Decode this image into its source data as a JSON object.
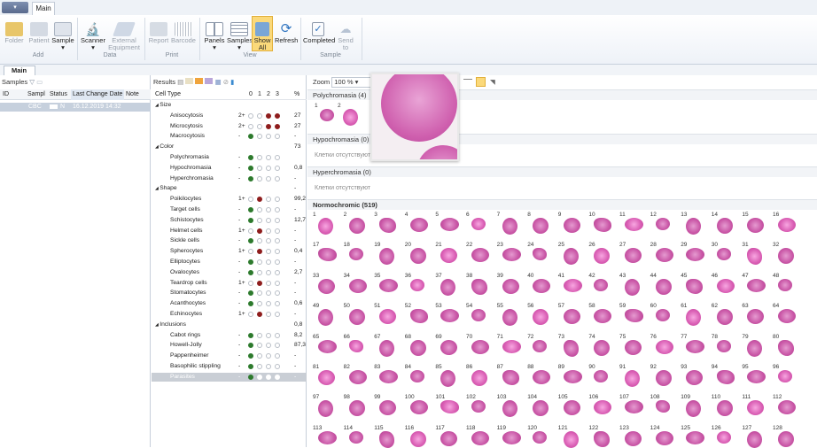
{
  "ribbon": {
    "tab": "Main",
    "groups": {
      "add": "Add",
      "data": "Data",
      "print": "Print",
      "view": "View",
      "sample": "Sample"
    },
    "buttons": {
      "folder": "Folder",
      "patient": "Patient",
      "sample": "Sample",
      "scanner": "Scanner",
      "external": "External Equipment",
      "report": "Report",
      "barcode": "Barcode",
      "panels": "Panels",
      "samples": "Samples",
      "show_all": "Show All",
      "refresh": "Refresh",
      "completed": "Completed",
      "send": "Send to"
    }
  },
  "doc_tab": "Main",
  "samples_panel": {
    "title": "Samples",
    "columns": [
      "ID",
      "Sampl",
      "Status",
      "Last Change Date",
      "Note"
    ],
    "row": {
      "sample": "CBC",
      "status": "N",
      "date": "16.12.2019 14:32"
    }
  },
  "results_panel": {
    "title": "Results",
    "header": {
      "cell_type": "Cell Type",
      "g0": "0",
      "g1": "1",
      "g2": "2",
      "g3": "3",
      "pct": "%"
    },
    "rows": [
      {
        "type": "cat",
        "name": "Size",
        "grade": "",
        "dots": [],
        "pct": ""
      },
      {
        "type": "item",
        "name": "Anisocytosis",
        "grade": "2+",
        "dots": [
          "o",
          "o",
          "r",
          "r"
        ],
        "pct": "27"
      },
      {
        "type": "item",
        "name": "Microcytosis",
        "grade": "2+",
        "dots": [
          "o",
          "o",
          "r",
          "r"
        ],
        "pct": "27"
      },
      {
        "type": "item",
        "name": "Macrocytosis",
        "grade": "-",
        "dots": [
          "g",
          "o",
          "o",
          "o"
        ],
        "pct": "-"
      },
      {
        "type": "cat",
        "name": "Color",
        "grade": "",
        "dots": [],
        "pct": "73"
      },
      {
        "type": "item",
        "name": "Polychromasia",
        "grade": "-",
        "dots": [
          "g",
          "o",
          "o",
          "o"
        ],
        "pct": ""
      },
      {
        "type": "item",
        "name": "Hypochromasia",
        "grade": "-",
        "dots": [
          "g",
          "o",
          "o",
          "o"
        ],
        "pct": "0,8"
      },
      {
        "type": "item",
        "name": "Hyperchromasia",
        "grade": "-",
        "dots": [
          "g",
          "o",
          "o",
          "o"
        ],
        "pct": "-"
      },
      {
        "type": "cat",
        "name": "Shape",
        "grade": "",
        "dots": [],
        "pct": "-"
      },
      {
        "type": "item",
        "name": "Poikilocytes",
        "grade": "1+",
        "dots": [
          "o",
          "r",
          "o",
          "o"
        ],
        "pct": "99,2"
      },
      {
        "type": "item",
        "name": "Target cells",
        "grade": "-",
        "dots": [
          "g",
          "o",
          "o",
          "o"
        ],
        "pct": "-"
      },
      {
        "type": "item",
        "name": "Schistocytes",
        "grade": "-",
        "dots": [
          "g",
          "o",
          "o",
          "o"
        ],
        "pct": "12,7"
      },
      {
        "type": "item",
        "name": "Helmet cells",
        "grade": "1+",
        "dots": [
          "o",
          "r",
          "o",
          "o"
        ],
        "pct": "-"
      },
      {
        "type": "item",
        "name": "Sickle cells",
        "grade": "-",
        "dots": [
          "g",
          "o",
          "o",
          "o"
        ],
        "pct": "-"
      },
      {
        "type": "item",
        "name": "Spherocytes",
        "grade": "1+",
        "dots": [
          "o",
          "r",
          "o",
          "o"
        ],
        "pct": "0,4"
      },
      {
        "type": "item",
        "name": "Elliptocytes",
        "grade": "-",
        "dots": [
          "g",
          "o",
          "o",
          "o"
        ],
        "pct": "-"
      },
      {
        "type": "item",
        "name": "Ovalocytes",
        "grade": "-",
        "dots": [
          "g",
          "o",
          "o",
          "o"
        ],
        "pct": "2,7"
      },
      {
        "type": "item",
        "name": "Teardrop cells",
        "grade": "1+",
        "dots": [
          "o",
          "r",
          "o",
          "o"
        ],
        "pct": "-"
      },
      {
        "type": "item",
        "name": "Stomatocytes",
        "grade": "-",
        "dots": [
          "g",
          "o",
          "o",
          "o"
        ],
        "pct": "-"
      },
      {
        "type": "item",
        "name": "Acanthocytes",
        "grade": "-",
        "dots": [
          "g",
          "o",
          "o",
          "o"
        ],
        "pct": "0,6"
      },
      {
        "type": "item",
        "name": "Echinocytes",
        "grade": "1+",
        "dots": [
          "o",
          "r",
          "o",
          "o"
        ],
        "pct": "-"
      },
      {
        "type": "cat",
        "name": "Inclusions",
        "grade": "",
        "dots": [],
        "pct": "0,8"
      },
      {
        "type": "item",
        "name": "Cabot rings",
        "grade": "-",
        "dots": [
          "g",
          "o",
          "o",
          "o"
        ],
        "pct": "8,2"
      },
      {
        "type": "item",
        "name": "Howell-Jolly",
        "grade": "-",
        "dots": [
          "g",
          "o",
          "o",
          "o"
        ],
        "pct": "87,3"
      },
      {
        "type": "item",
        "name": "Pappenheimer",
        "grade": "-",
        "dots": [
          "g",
          "o",
          "o",
          "o"
        ],
        "pct": "-"
      },
      {
        "type": "item",
        "name": "Basophilic stippling",
        "grade": "-",
        "dots": [
          "g",
          "o",
          "o",
          "o"
        ],
        "pct": "-"
      },
      {
        "type": "item",
        "name": "Parasites",
        "grade": "-",
        "dots": [
          "g",
          "w",
          "w",
          "w"
        ],
        "pct": "-",
        "selected": true
      }
    ]
  },
  "gallery": {
    "zoom_label": "Zoom",
    "zoom_value": "100 %",
    "sections": {
      "poly": "Polychromasia (4)",
      "hypo": "Hypochromasia (0)",
      "hyper": "Hyperchromasia (0)",
      "normo": "Normochromic (519)"
    },
    "empty_text": "Клетки отсутствуют",
    "poly_count": 2,
    "normo_rows": 8,
    "normo_cols": 16
  },
  "colors": {
    "selected_row": "#c6d0dd",
    "cell": "#c956a6",
    "grade_green": "#2d7a2d",
    "grade_red": "#8e1d1d"
  }
}
